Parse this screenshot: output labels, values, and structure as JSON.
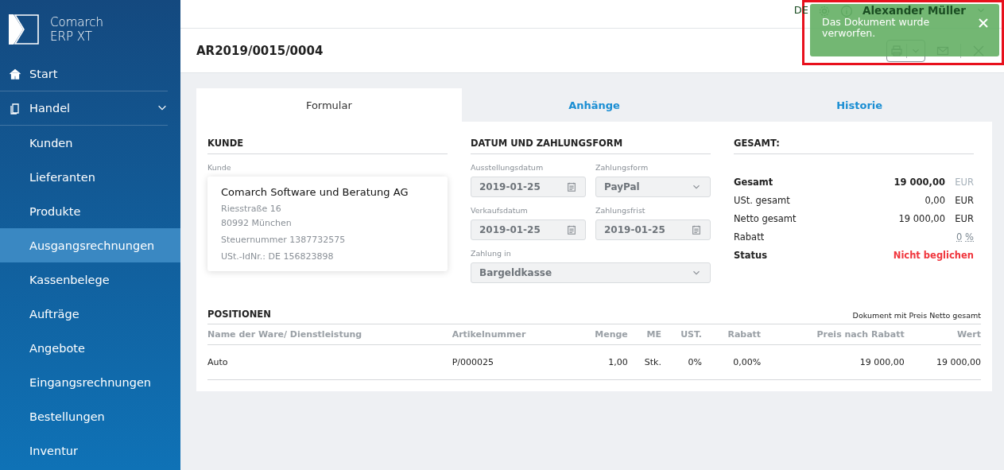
{
  "app": {
    "name": "Comarch ERP XT"
  },
  "sidebar": {
    "items": [
      {
        "label": "Start",
        "selected": false
      },
      {
        "label": "Handel",
        "expanded": true,
        "selected": false,
        "children": [
          {
            "label": "Kunden",
            "selected": false
          },
          {
            "label": "Lieferanten",
            "selected": false
          },
          {
            "label": "Produkte",
            "selected": false
          },
          {
            "label": "Ausgangsrechnungen",
            "selected": true
          },
          {
            "label": "Kassenbelege",
            "selected": false
          },
          {
            "label": "Aufträge",
            "selected": false
          },
          {
            "label": "Angebote",
            "selected": false
          },
          {
            "label": "Eingangsrechnungen",
            "selected": false
          },
          {
            "label": "Bestellungen",
            "selected": false
          },
          {
            "label": "Inventur",
            "selected": false
          }
        ]
      }
    ]
  },
  "header": {
    "language": "DE",
    "user": "Alexander Müller"
  },
  "document": {
    "title": "AR2019/0015/0004"
  },
  "tabs": [
    {
      "label": "Formular",
      "selected": true
    },
    {
      "label": "Anhänge",
      "selected": false
    },
    {
      "label": "Historie",
      "selected": false
    }
  ],
  "customer": {
    "heading": "KUNDE",
    "label": "Kunde",
    "name": "Comarch Software und Beratung AG",
    "lines": [
      "Riesstraße 16",
      "80992 München",
      "Steuernummer 1387732575",
      "USt.-IdNr.: DE 156823898"
    ]
  },
  "payment": {
    "heading": "DATUM UND ZAHLUNGSFORM",
    "fields": [
      {
        "label": "Ausstellungsdatum",
        "value": "2019-01-25",
        "kind": "date",
        "wide": false
      },
      {
        "label": "Zahlungsform",
        "value": "PayPal",
        "kind": "select",
        "wide": false
      },
      {
        "label": "Verkaufsdatum",
        "value": "2019-01-25",
        "kind": "date",
        "wide": false
      },
      {
        "label": "Zahlungsfrist",
        "value": "2019-01-25",
        "kind": "date",
        "wide": false
      },
      {
        "label": "Zahlung in",
        "value": "Bargeldkasse",
        "kind": "select",
        "wide": true
      }
    ]
  },
  "totals": {
    "heading": "GESAMT:",
    "rows": [
      {
        "kind": "amount",
        "label": "Gesamt",
        "value": "19 000,00",
        "unit": "EUR",
        "bold": true
      },
      {
        "kind": "amount",
        "label": "USt. gesamt",
        "value": "0,00",
        "unit": "EUR",
        "bold": false
      },
      {
        "kind": "amount",
        "label": "Netto gesamt",
        "value": "19 000,00",
        "unit": "EUR",
        "bold": false
      },
      {
        "kind": "link",
        "label": "Rabatt",
        "value": "0",
        "unit": "%",
        "bold": false
      },
      {
        "kind": "status",
        "label": "Status",
        "value": "Nicht beglichen",
        "bold": true
      }
    ]
  },
  "positions": {
    "heading": "POSITIONEN",
    "note": "Dokument mit Preis Netto gesamt",
    "columns": [
      "Name der Ware/ Dienstleistung",
      "Artikelnummer",
      "Menge",
      "ME",
      "UST.",
      "Rabatt",
      "Preis nach Rabatt",
      "Wert"
    ],
    "rows": [
      [
        "Auto",
        "P/000025",
        "1,00",
        "Stk.",
        "0%",
        "0,00%",
        "19 000,00",
        "19 000,00"
      ]
    ]
  },
  "toast": {
    "message": "Das Dokument wurde verworfen."
  }
}
